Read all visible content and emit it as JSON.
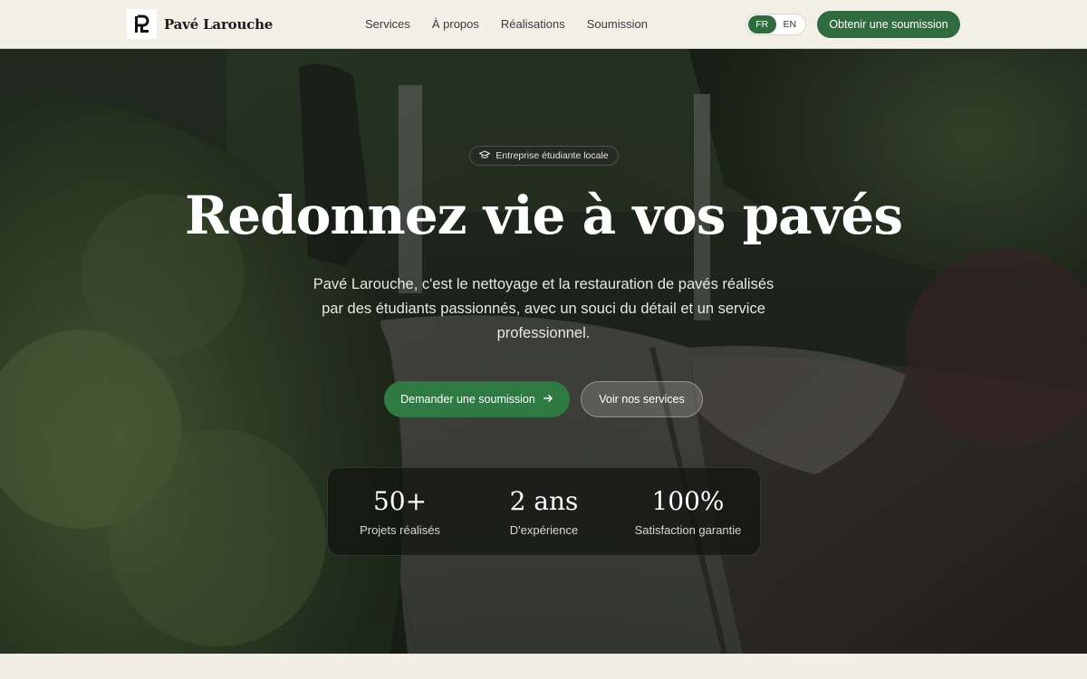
{
  "header": {
    "brand_name": "Pavé Larouche",
    "logo_icon": "pl-monogram-icon",
    "nav": [
      "Services",
      "À propos",
      "Réalisations",
      "Soumission"
    ],
    "lang": {
      "fr": "FR",
      "en": "EN",
      "active": "FR"
    },
    "cta_label": "Obtenir une soumission"
  },
  "hero": {
    "badge_icon": "graduation-cap-icon",
    "badge_label": "Entreprise étudiante locale",
    "title": "Redonnez vie à vos pavés",
    "subtitle": "Pavé Larouche, c'est le nettoyage et la restauration de pavés réalisés par des étudiants passionnés, avec un souci du détail et un service professionnel.",
    "primary_button": "Demander une soumission",
    "primary_button_icon": "arrow-right-icon",
    "secondary_button": "Voir nos services",
    "stats": [
      {
        "value": "50+",
        "label": "Projets réalisés"
      },
      {
        "value": "2 ans",
        "label": "D'expérience"
      },
      {
        "value": "100%",
        "label": "Satisfaction garantie"
      }
    ]
  },
  "colors": {
    "accent_green": "#2f6b3f",
    "header_bg": "#f2efe7"
  }
}
